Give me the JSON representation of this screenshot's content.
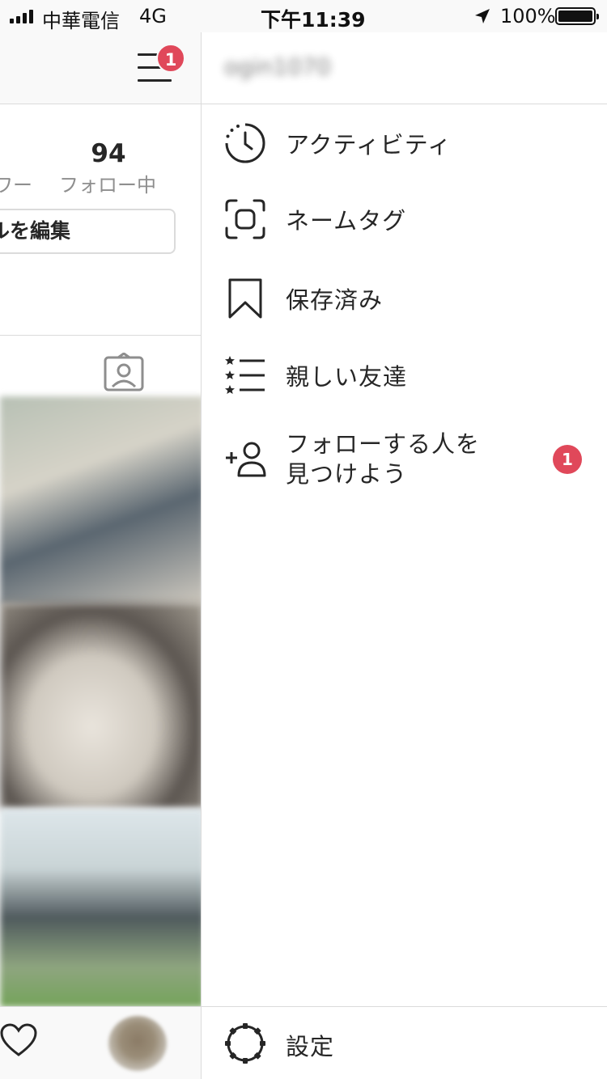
{
  "status_bar": {
    "carrier": "中華電信",
    "network": "4G",
    "time": "下午11:39",
    "battery": "100%",
    "icons": [
      "signal-icon",
      "location-arrow-icon",
      "battery-icon"
    ]
  },
  "background_profile": {
    "menu_badge": "1",
    "following_count": "94",
    "followers_label_partial": "ワー",
    "following_label": "フォロー中",
    "edit_profile_label_partial": "ルを編集",
    "icons": [
      "hamburger-menu-icon",
      "tagged-photos-icon",
      "heart-icon",
      "profile-avatar"
    ]
  },
  "drawer": {
    "username": "ogin1070",
    "menu": [
      {
        "label": "アクティビティ",
        "icon": "activity-clock-icon"
      },
      {
        "label": "ネームタグ",
        "icon": "nametag-icon"
      },
      {
        "label": "保存済み",
        "icon": "bookmark-icon"
      },
      {
        "label": "親しい友達",
        "icon": "close-friends-list-icon"
      },
      {
        "label": "フォローする人を見つけよう",
        "icon": "add-person-icon",
        "badge": "1"
      }
    ],
    "footer": {
      "label": "設定",
      "icon": "settings-gear-icon"
    }
  },
  "colors": {
    "badge": "#e0485a",
    "divider": "#dbdbdb",
    "text": "#262626",
    "secondary_text": "#8e8e8e"
  }
}
